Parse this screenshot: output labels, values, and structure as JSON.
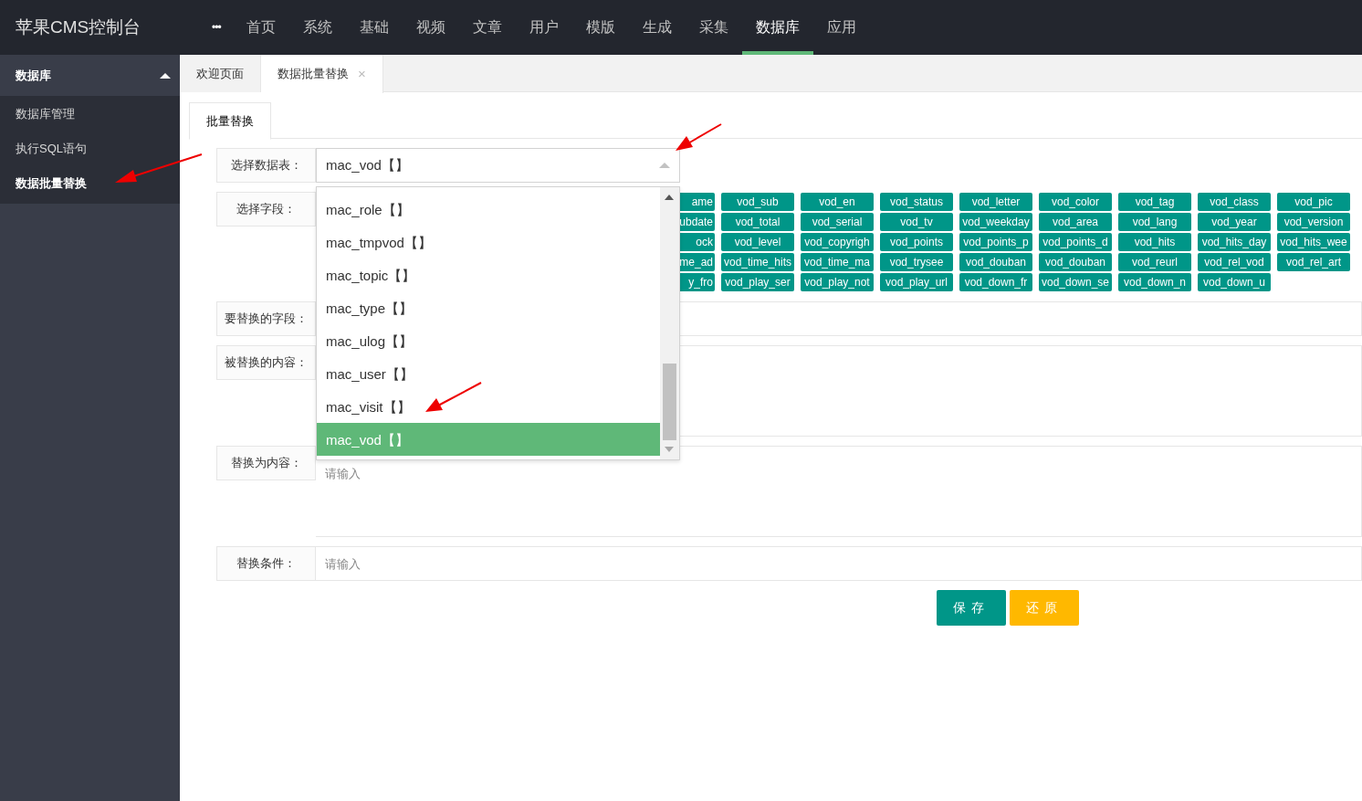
{
  "app_title": "苹果CMS控制台",
  "top_nav": {
    "more": "•••",
    "items": [
      {
        "label": "首页",
        "selected": false
      },
      {
        "label": "系统",
        "selected": false
      },
      {
        "label": "基础",
        "selected": false
      },
      {
        "label": "视频",
        "selected": false
      },
      {
        "label": "文章",
        "selected": false
      },
      {
        "label": "用户",
        "selected": false
      },
      {
        "label": "模版",
        "selected": false
      },
      {
        "label": "生成",
        "selected": false
      },
      {
        "label": "采集",
        "selected": false
      },
      {
        "label": "数据库",
        "selected": true
      },
      {
        "label": "应用",
        "selected": false
      }
    ]
  },
  "sidebar": {
    "group": {
      "label": "数据库",
      "expanded": true
    },
    "items": [
      {
        "label": "数据库管理",
        "selected": false
      },
      {
        "label": "执行SQL语句",
        "selected": false
      },
      {
        "label": "数据批量替换",
        "selected": true
      }
    ]
  },
  "page_tabs": [
    {
      "label": "欢迎页面",
      "selected": false
    },
    {
      "label": "数据批量替换",
      "selected": true,
      "close": "×"
    }
  ],
  "form_tabs": [
    {
      "label": "批量替换",
      "selected": true
    }
  ],
  "form": {
    "table_select": {
      "label": "选择数据表：",
      "value": "mac_vod【】",
      "expanded": true,
      "options": [
        {
          "label": "mac_role【】",
          "selected": false
        },
        {
          "label": "mac_tmpvod【】",
          "selected": false
        },
        {
          "label": "mac_topic【】",
          "selected": false
        },
        {
          "label": "mac_type【】",
          "selected": false
        },
        {
          "label": "mac_ulog【】",
          "selected": false
        },
        {
          "label": "mac_user【】",
          "selected": false
        },
        {
          "label": "mac_visit【】",
          "selected": false
        },
        {
          "label": "mac_vod【】",
          "selected": true
        }
      ]
    },
    "field_select": {
      "label": "选择字段：",
      "tags": [
        "ame",
        "vod_sub",
        "vod_en",
        "vod_status",
        "vod_letter",
        "vod_color",
        "vod_tag",
        "vod_class",
        "vod_pic",
        "ubdate",
        "vod_total",
        "vod_serial",
        "vod_tv",
        "vod_weekday",
        "vod_area",
        "vod_lang",
        "vod_year",
        "vod_version",
        "ock",
        "vod_level",
        "vod_copyrigh",
        "vod_points",
        "vod_points_p",
        "vod_points_d",
        "vod_hits",
        "vod_hits_day",
        "vod_hits_wee",
        "me_ad",
        "vod_time_hits",
        "vod_time_ma",
        "vod_trysee",
        "vod_douban",
        "vod_douban",
        "vod_reurl",
        "vod_rel_vod",
        "vod_rel_art",
        "y_fro",
        "vod_play_ser",
        "vod_play_not",
        "vod_play_url",
        "vod_down_fr",
        "vod_down_se",
        "vod_down_n",
        "vod_down_u"
      ]
    },
    "replace_field": {
      "label": "要替换的字段："
    },
    "find_content": {
      "label": "被替换的内容："
    },
    "replace_content": {
      "label": "替换为内容：",
      "placeholder": "请输入"
    },
    "condition": {
      "label": "替换条件：",
      "placeholder": "请输入"
    }
  },
  "buttons": [
    {
      "label": "保存",
      "kind": "primary"
    },
    {
      "label": "还原",
      "kind": "warning"
    }
  ]
}
